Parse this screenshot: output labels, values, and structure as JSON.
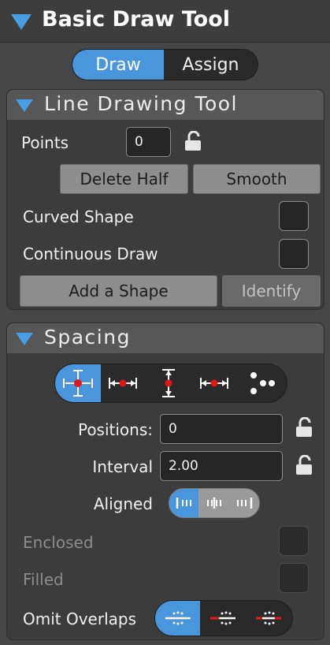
{
  "header": {
    "title": "Basic Draw Tool"
  },
  "mode_toggle": {
    "options": [
      "Draw",
      "Assign"
    ],
    "selected": "Draw"
  },
  "line_tool": {
    "title": "Line Drawing Tool",
    "points_label": "Points",
    "points_value": "0",
    "delete_half_label": "Delete Half",
    "smooth_label": "Smooth",
    "curved_label": "Curved Shape",
    "curved_checked": false,
    "continuous_label": "Continuous Draw",
    "continuous_checked": false,
    "add_shape_label": "Add a Shape",
    "identify_label": "Identify"
  },
  "spacing": {
    "title": "Spacing",
    "modes": [
      "expand-icon",
      "horizontal-spacing-icon",
      "vertical-spacing-icon",
      "horizontal-spacing-alt-icon",
      "scatter-icon"
    ],
    "selected_mode": "expand-icon",
    "positions_label": "Positions:",
    "positions_value": "0",
    "interval_label": "Interval",
    "interval_value": "2.00",
    "aligned_label": "Aligned",
    "aligned_options": [
      "align-left-icon",
      "align-center-icon",
      "align-right-icon"
    ],
    "aligned_selected": "align-left-icon",
    "enclosed_label": "Enclosed",
    "filled_label": "Filled",
    "omit_label": "Omit Overlaps",
    "omit_options": [
      "omit-none-icon",
      "omit-cut-icon",
      "omit-cross-icon"
    ],
    "omit_selected": "omit-none-icon"
  },
  "colors": {
    "accent": "#4a96dc",
    "marker": "#e01818"
  }
}
